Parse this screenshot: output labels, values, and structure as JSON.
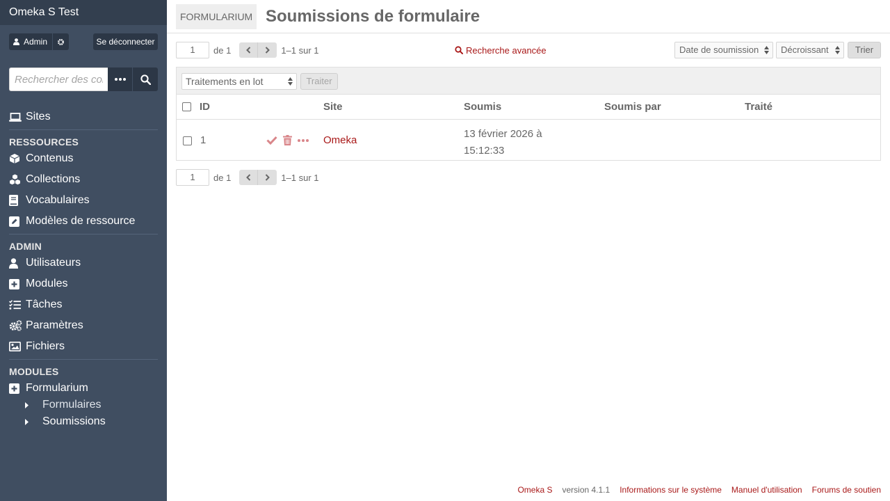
{
  "install_title": "Omeka S Test",
  "user": {
    "name": "Admin",
    "logout_label": "Se déconnecter"
  },
  "search": {
    "placeholder": "Rechercher des contenus",
    "options_label": "•••"
  },
  "nav": {
    "sites_label": "Sites",
    "resources_heading": "RESSOURCES",
    "resources": [
      {
        "label": "Contenus",
        "icon": "cube-icon"
      },
      {
        "label": "Collections",
        "icon": "cubes-icon"
      },
      {
        "label": "Vocabulaires",
        "icon": "book-icon"
      },
      {
        "label": "Modèles de ressource",
        "icon": "edit-icon"
      }
    ],
    "admin_heading": "ADMIN",
    "admin": [
      {
        "label": "Utilisateurs",
        "icon": "user-icon"
      },
      {
        "label": "Modules",
        "icon": "plus-square-icon"
      },
      {
        "label": "Tâches",
        "icon": "tasks-icon"
      },
      {
        "label": "Paramètres",
        "icon": "cogs-icon"
      },
      {
        "label": "Fichiers",
        "icon": "image-icon"
      }
    ],
    "modules_heading": "MODULES",
    "module_item": "Formularium",
    "module_subitems": [
      "Formulaires",
      "Soumissions"
    ]
  },
  "header": {
    "module_badge": "FORMULARIUM",
    "title": "Soumissions de formulaire"
  },
  "pagination": {
    "page": "1",
    "of_label": "de 1",
    "count": "1–1 sur 1"
  },
  "advanced_search_label": "Recherche avancée",
  "sort": {
    "by": "Date de soumission",
    "order": "Décroissant",
    "button": "Trier"
  },
  "batch": {
    "select": "Traitements en lot",
    "button": "Traiter"
  },
  "table": {
    "columns": [
      "ID",
      "Site",
      "Soumis",
      "Soumis par",
      "Traité"
    ],
    "rows": [
      {
        "id": "1",
        "site": "Omeka",
        "submitted_line1": "13 février 2026 à",
        "submitted_line2": "15:12:33",
        "submitted_by": "",
        "processed": ""
      }
    ]
  },
  "footer": {
    "app": "Omeka S",
    "version": "version 4.1.1",
    "links": [
      "Informations sur le système",
      "Manuel d'utilisation",
      "Forums de soutien"
    ]
  },
  "colors": {
    "sidebar": "#404e61",
    "accent": "#a91919",
    "text": "#676767"
  }
}
